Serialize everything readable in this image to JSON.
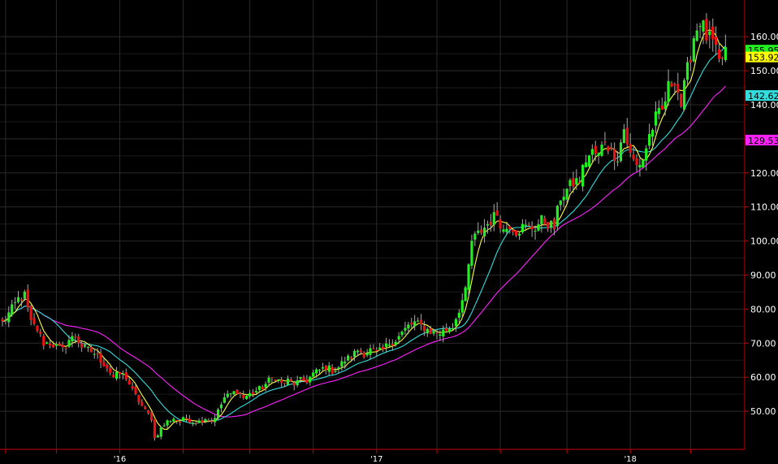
{
  "chart_data": {
    "type": "candlestick",
    "frequency": "weekly",
    "ylim": [
      40,
      166
    ],
    "y_ticks": [
      {
        "value": 160,
        "label": "160.00"
      },
      {
        "value": 150,
        "label": "150.00"
      },
      {
        "value": 140,
        "label": "140.00"
      },
      {
        "value": 130,
        "label": "130.00"
      },
      {
        "value": 120,
        "label": "120.00"
      },
      {
        "value": 110,
        "label": "110.00"
      },
      {
        "value": 100,
        "label": "100.00"
      },
      {
        "value": 90,
        "label": "90.00"
      },
      {
        "value": 80,
        "label": "80.00"
      },
      {
        "value": 70,
        "label": "70.00"
      },
      {
        "value": 60,
        "label": "60.00"
      },
      {
        "value": 50,
        "label": "50.00"
      }
    ],
    "x_labels": [
      {
        "bar": 37,
        "label": "'16"
      },
      {
        "bar": 118,
        "label": "'17"
      },
      {
        "bar": 198,
        "label": "'18"
      }
    ],
    "x_minor_ticks": [
      1,
      17,
      37,
      57,
      78,
      98,
      118,
      137,
      157,
      178,
      198,
      217
    ],
    "colors": {
      "up": "#22ee22",
      "down": "#ee1111",
      "wick": "#aaaaaa",
      "ma_fast": "#ffff44",
      "ma_mid": "#33dddd",
      "ma_slow": "#ff22ff",
      "grid": "#2a2a2a",
      "axis": "#cc0000",
      "background": "#000000"
    },
    "price_tags": [
      {
        "value": 155.95,
        "label": "155.95",
        "color": "#22ee22"
      },
      {
        "value": 153.92,
        "label": "153.92",
        "color": "#ffff00"
      },
      {
        "value": 142.62,
        "label": "142.62",
        "color": "#33dddd"
      },
      {
        "value": 129.53,
        "label": "129.53",
        "color": "#ff22ff"
      }
    ],
    "close_anchors": [
      [
        0,
        76
      ],
      [
        3,
        80
      ],
      [
        5,
        83
      ],
      [
        7,
        84
      ],
      [
        9,
        76
      ],
      [
        11,
        74
      ],
      [
        13,
        70
      ],
      [
        15,
        70
      ],
      [
        17,
        69
      ],
      [
        19,
        68
      ],
      [
        21,
        71
      ],
      [
        23,
        72
      ],
      [
        25,
        69
      ],
      [
        27,
        68
      ],
      [
        29,
        67
      ],
      [
        31,
        65
      ],
      [
        33,
        63
      ],
      [
        35,
        60
      ],
      [
        37,
        61
      ],
      [
        39,
        60
      ],
      [
        41,
        56
      ],
      [
        43,
        53
      ],
      [
        45,
        50
      ],
      [
        47,
        48
      ],
      [
        48,
        42
      ],
      [
        50,
        45
      ],
      [
        52,
        47
      ],
      [
        54,
        48
      ],
      [
        56,
        47
      ],
      [
        58,
        48
      ],
      [
        60,
        47
      ],
      [
        62,
        47
      ],
      [
        64,
        48
      ],
      [
        66,
        47
      ],
      [
        68,
        50
      ],
      [
        70,
        54
      ],
      [
        72,
        55
      ],
      [
        74,
        56
      ],
      [
        76,
        54
      ],
      [
        78,
        55
      ],
      [
        80,
        56
      ],
      [
        82,
        57
      ],
      [
        84,
        59
      ],
      [
        86,
        60
      ],
      [
        88,
        58
      ],
      [
        90,
        59
      ],
      [
        92,
        58
      ],
      [
        94,
        59
      ],
      [
        96,
        59
      ],
      [
        98,
        61
      ],
      [
        100,
        62
      ],
      [
        102,
        63
      ],
      [
        104,
        62
      ],
      [
        106,
        63
      ],
      [
        108,
        65
      ],
      [
        110,
        66
      ],
      [
        112,
        68
      ],
      [
        114,
        67
      ],
      [
        116,
        68
      ],
      [
        118,
        67
      ],
      [
        120,
        68
      ],
      [
        122,
        70
      ],
      [
        124,
        71
      ],
      [
        126,
        73
      ],
      [
        128,
        75
      ],
      [
        130,
        76
      ],
      [
        132,
        75
      ],
      [
        134,
        74
      ],
      [
        136,
        73
      ],
      [
        138,
        73
      ],
      [
        140,
        74
      ],
      [
        142,
        75
      ],
      [
        144,
        80
      ],
      [
        146,
        85
      ],
      [
        148,
        100
      ],
      [
        150,
        102
      ],
      [
        152,
        104
      ],
      [
        154,
        106
      ],
      [
        156,
        108
      ],
      [
        158,
        103
      ],
      [
        160,
        105
      ],
      [
        162,
        103
      ],
      [
        164,
        104
      ],
      [
        166,
        104
      ],
      [
        168,
        104
      ],
      [
        170,
        106
      ],
      [
        172,
        105
      ],
      [
        174,
        104
      ],
      [
        176,
        113
      ],
      [
        178,
        115
      ],
      [
        180,
        117
      ],
      [
        182,
        118
      ],
      [
        184,
        124
      ],
      [
        186,
        126
      ],
      [
        188,
        125
      ],
      [
        190,
        130
      ],
      [
        192,
        126
      ],
      [
        194,
        125
      ],
      [
        196,
        133
      ],
      [
        198,
        125
      ],
      [
        200,
        122
      ],
      [
        202,
        124
      ],
      [
        204,
        131
      ],
      [
        206,
        136
      ],
      [
        208,
        138
      ],
      [
        210,
        145
      ],
      [
        212,
        148
      ],
      [
        214,
        140
      ],
      [
        216,
        150
      ],
      [
        218,
        160
      ],
      [
        220,
        165
      ],
      [
        222,
        160
      ],
      [
        224,
        158
      ],
      [
        226,
        152
      ],
      [
        228,
        156
      ]
    ]
  }
}
